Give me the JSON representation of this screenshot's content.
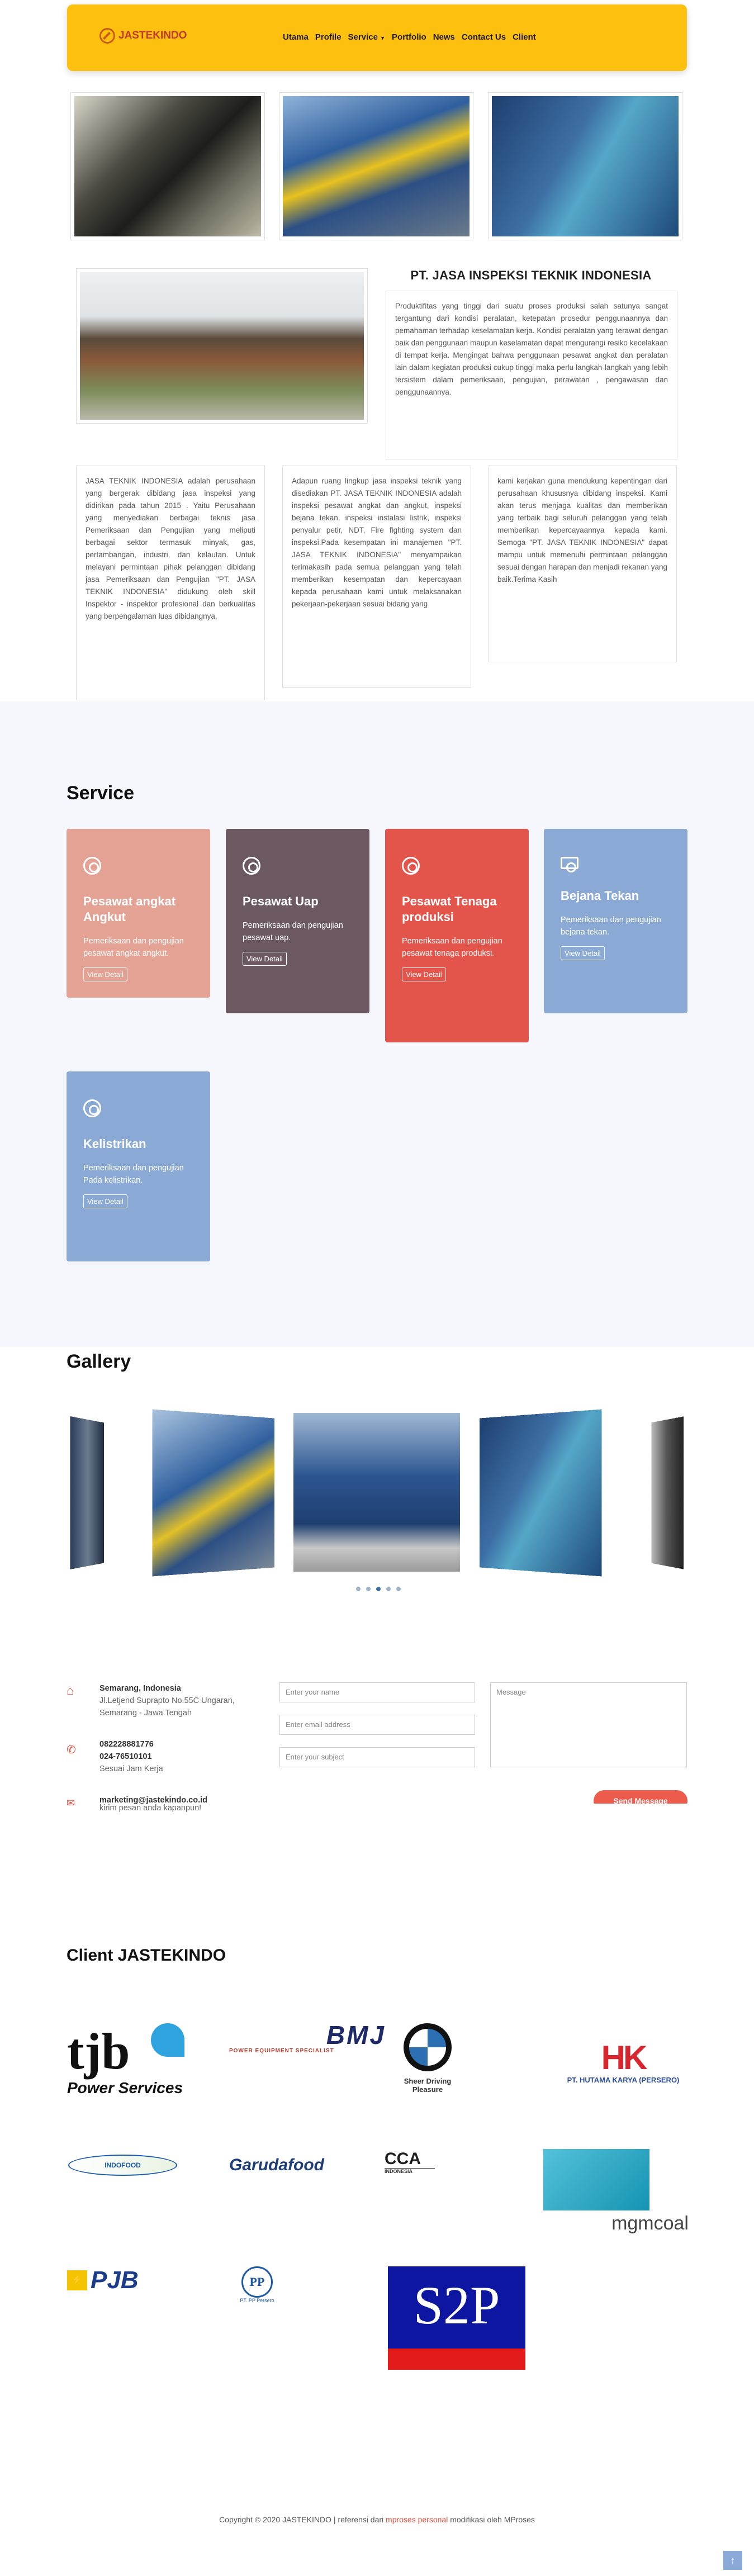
{
  "header": {
    "logo_text": "JASTEKINDO",
    "nav": [
      "Utama",
      "Profile",
      "Service",
      "Portfolio",
      "News",
      "Contact Us",
      "Client"
    ]
  },
  "company": {
    "title": "PT. JASA INSPEKSI TEKNIK INDONESIA",
    "intro": "Produktifitas yang tinggi dari suatu proses produksi salah satunya sangat tergantung dari kondisi peralatan, ketepatan prosedur penggunaannya dan pemahaman terhadap keselamatan kerja. Kondisi peralatan yang terawat dengan baik dan penggunaan maupun keselamatan dapat mengurangi resiko kecelakaan di tempat kerja. Mengingat bahwa penggunaan pesawat angkat dan peralatan lain dalam kegiatan produksi cukup tinggi maka perlu langkah-langkah yang lebih tersistem dalam pemeriksaan, pengujian, perawatan , pengawasan dan penggunaannya.",
    "col1": "JASA TEKNIK INDONESIA adalah perusahaan yang bergerak dibidang jasa inspeksi yang didirikan pada tahun 2015 . Yaitu Perusahaan yang menyediakan berbagai teknis jasa Pemeriksaan dan Pengujian yang meliputi berbagai sektor termasuk minyak, gas, pertambangan, industri, dan kelautan. Untuk melayani permintaan pihak pelanggan dibidang jasa Pemeriksaan dan Pengujian \"PT. JASA TEKNIK INDONESIA\" didukung oleh skill Inspektor - inspektor profesional dan berkualitas yang berpengalaman luas dibidangnya.",
    "col2": "Adapun ruang lingkup jasa inspeksi teknik yang disediakan PT. JASA TEKNIK INDONESIA adalah inspeksi pesawat angkat dan angkut, inspeksi bejana tekan, inspeksi instalasi listrik, inspeksi penyalur petir, NDT, Fire fighting system dan inspeksi.Pada kesempatan ini manajemen \"PT. JASA TEKNIK INDONESIA\" menyampaikan terimakasih pada semua pelanggan yang telah memberikan kesempatan dan kepercayaan kepada perusahaan kami untuk melaksanakan pekerjaan-pekerjaan sesuai bidang yang",
    "col3": "kami kerjakan guna mendukung kepentingan dari perusahaan khususnya dibidang inspeksi. Kami akan terus menjaga kualitas dan memberikan yang terbaik bagi seluruh pelanggan yang telah memberikan kepercayaannya kepada kami. Semoga \"PT. JASA TEKNIK INDONESIA\" dapat mampu untuk memenuhi permintaan pelanggan sesuai dengan harapan dan menjadi rekanan yang baik.Terima Kasih"
  },
  "service": {
    "heading": "Service",
    "cards": [
      {
        "title": "Pesawat angkat Angkut",
        "desc": "Pemeriksaan dan pengujian pesawat angkat angkut.",
        "btn": "View Detail",
        "color": "#e3a294"
      },
      {
        "title": "Pesawat Uap",
        "desc": "Pemeriksaan dan pengujian pesawat uap.",
        "btn": "View Detail",
        "color": "#6b5861"
      },
      {
        "title": "Pesawat Tenaga produksi",
        "desc": "Pemeriksaan dan pengujian pesawat tenaga produksi.",
        "btn": "View Detail",
        "color": "#e3544a"
      },
      {
        "title": "Bejana Tekan",
        "desc": "Pemeriksaan dan pengujian bejana tekan.",
        "btn": "View Detail",
        "color": "#8aaad5"
      },
      {
        "title": "Kelistrikan",
        "desc": "Pemeriksaan dan pengujian Pada kelistrikan.",
        "btn": "View Detail",
        "color": "#8aaad5"
      }
    ]
  },
  "gallery": {
    "heading": "Gallery"
  },
  "contact": {
    "address_title": "Semarang, Indonesia",
    "address_line": "Jl.Letjend Suprapto No.55C Ungaran, Semarang - Jawa Tengah",
    "phone1": "082228881776",
    "phone2": "024-76510101",
    "phone_note": "Sesuai Jam Kerja",
    "email": "marketing@jastekindo.co.id",
    "email_note": "kirim pesan anda kapanpun!",
    "name_ph": "Enter your name",
    "email_ph": "Enter email address",
    "subject_ph": "Enter your subject",
    "message_ph": "Message",
    "send": "Send Message"
  },
  "clients": {
    "heading": "Client JASTEKINDO",
    "tjb": "tjb",
    "tjb_sub": "Power Services",
    "bmj": "BMJ",
    "bmj_sub": "POWER EQUIPMENT SPECIALIST",
    "bmw_sub": "Sheer Driving Pleasure",
    "hk": "PT. HUTAMA KARYA (PERSERO)",
    "indofood": "INDOFOOD",
    "garudafood": "Garudafood",
    "cca": "CCA",
    "cca_sub": "INDONESIA",
    "mgm": "mgmcoal",
    "pjb": "PJB",
    "pp": "PT. PP Persero",
    "s2p": "S2P"
  },
  "footer": {
    "text1": "Copyright © 2020 JASTEKINDO | referensi dari ",
    "link": "mproses personal",
    "text2": " modifikasi oleh MProses",
    "top": "↑"
  },
  "colors": {
    "accent": "#fdc00f",
    "brand_red": "#c0392b",
    "send": "#ec5b4c"
  }
}
